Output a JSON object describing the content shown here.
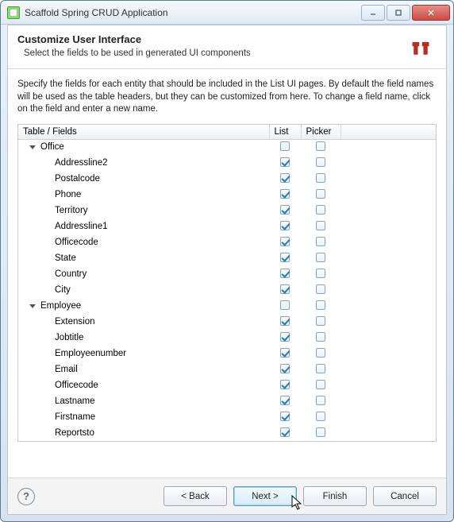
{
  "window": {
    "title": "Scaffold Spring CRUD Application"
  },
  "header": {
    "title": "Customize User Interface",
    "subtitle": "Select the fields to be used in generated UI components"
  },
  "body": {
    "instructions": "Specify the fields for each entity that should be included in the List UI pages. By default the field names will be used as the table headers, but they can be customized from here. To change a field name, click on the field and enter a new name."
  },
  "table": {
    "headers": {
      "fields": "Table / Fields",
      "list": "List",
      "picker": "Picker"
    },
    "rows": [
      {
        "type": "group",
        "label": "Office",
        "list": false,
        "picker": false
      },
      {
        "type": "leaf",
        "label": "Addressline2",
        "list": true,
        "picker": false
      },
      {
        "type": "leaf",
        "label": "Postalcode",
        "list": true,
        "picker": false
      },
      {
        "type": "leaf",
        "label": "Phone",
        "list": true,
        "picker": false
      },
      {
        "type": "leaf",
        "label": "Territory",
        "list": true,
        "picker": false
      },
      {
        "type": "leaf",
        "label": "Addressline1",
        "list": true,
        "picker": false
      },
      {
        "type": "leaf",
        "label": "Officecode",
        "list": true,
        "picker": false
      },
      {
        "type": "leaf",
        "label": "State",
        "list": true,
        "picker": false
      },
      {
        "type": "leaf",
        "label": "Country",
        "list": true,
        "picker": false
      },
      {
        "type": "leaf",
        "label": "City",
        "list": true,
        "picker": false
      },
      {
        "type": "group",
        "label": "Employee",
        "list": false,
        "picker": false
      },
      {
        "type": "leaf",
        "label": "Extension",
        "list": true,
        "picker": false
      },
      {
        "type": "leaf",
        "label": "Jobtitle",
        "list": true,
        "picker": false
      },
      {
        "type": "leaf",
        "label": "Employeenumber",
        "list": true,
        "picker": false
      },
      {
        "type": "leaf",
        "label": "Email",
        "list": true,
        "picker": false
      },
      {
        "type": "leaf",
        "label": "Officecode",
        "list": true,
        "picker": false
      },
      {
        "type": "leaf",
        "label": "Lastname",
        "list": true,
        "picker": false
      },
      {
        "type": "leaf",
        "label": "Firstname",
        "list": true,
        "picker": false
      },
      {
        "type": "leaf",
        "label": "Reportsto",
        "list": true,
        "picker": false
      }
    ]
  },
  "buttons": {
    "back": "< Back",
    "next": "Next >",
    "finish": "Finish",
    "cancel": "Cancel"
  }
}
